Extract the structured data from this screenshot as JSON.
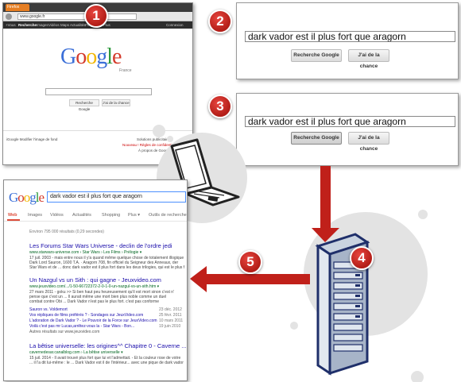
{
  "steps": {
    "s1": "1",
    "s2": "2",
    "s3": "3",
    "s4": "4",
    "s5": "5"
  },
  "browser": {
    "tab_label": "Firefox",
    "url": "www.google.fr",
    "nav_items": [
      "+Vous",
      "Recherche",
      "Images",
      "Vidéos",
      "Maps",
      "Actualités",
      "Play",
      "Gmail",
      "Plus"
    ],
    "connect": "Connexion",
    "logo_letters": [
      "G",
      "o",
      "o",
      "g",
      "l",
      "e"
    ],
    "logo_colors": [
      "#3b6fd8",
      "#d43a2a",
      "#f2b705",
      "#3b6fd8",
      "#2e9a3e",
      "#d43a2a"
    ],
    "country": "France",
    "btn_search": "Recherche Google",
    "btn_lucky": "J'ai de la chance",
    "footer_left": "iGoogle    Modifier l'image de fond",
    "footer_right_1": "Solutions publicitaires",
    "footer_right_2": "Nouveau ! Règles de confidentialité",
    "footer_right_3": "À propos de Google"
  },
  "query_panel_2": {
    "query": "dark vador est il plus fort que aragorn",
    "btn_search": "Recherche Google",
    "btn_lucky": "J'ai de la chance"
  },
  "query_panel_3": {
    "query": "dark vador est il plus fort que aragorn",
    "btn_search": "Recherche Google",
    "btn_lucky": "J'ai de la chance"
  },
  "results": {
    "query": "dark vador est il plus fort que aragorn",
    "nav": [
      "Web",
      "Images",
      "Vidéos",
      "Actualités",
      "Shopping",
      "Plus ▾",
      "Outils de recherche"
    ],
    "count": "Environ 795 000 résultats (0,29 secondes)",
    "items": [
      {
        "title": "Les Forums Star Wars Universe - declin de l'ordre jedi",
        "url": "www.starwars-universe.com › Star Wars › Les Films › Prélogie ▾",
        "snippets": [
          "17 juil. 2003 - mais entre nous il y'a quand même quelque chose de totalement illogique",
          "Dark Lord Sauron, 1600 T.A. · Aragorn 708, fin officiel du Seigneur des Anneaux, der",
          "Star Wars et de ... donc dark vador est il plus fort dans les deux trilogies, qui est le plus fort."
        ]
      },
      {
        "title": "Un Nazgul vs un Sith : qui gagne - Jeuxvideo.com",
        "url": "www.jeuxvideo.com/.../1-50-66722372-2-0-1-0-un-nazgul-vs-un-sith.htm ▾",
        "snippets": [
          "27 mars 2011 - goku >> Si ben haut peu heureusement qu'il est mort sinon c'est n'",
          "pense que c'est un ... Il aurait même une mort bien plus noble comme un duel",
          "combat contre Obi ... Dark Vador n'est pas le plus fort. c'est pas conforme"
        ],
        "sublinks": [
          {
            "text": "Sauron vs. Voldemort",
            "date": "23 déc. 2012"
          },
          {
            "text": "Vos répliques de films préférés ? - Sondages sur JeuxVideo.com",
            "date": "25 févr. 2011"
          },
          {
            "text": "L'adoration de Dark Vador ? - Le Pouvoir de la Force sur JeuxVideo.com",
            "date": "10 mars 2011"
          },
          {
            "text": "Voilà c'est pas mr Lucas,arrêtez-vous la - Star Wars - Bon...",
            "date": "19 juin 2010"
          }
        ],
        "more": "Autres résultats sur www.jeuxvideo.com"
      },
      {
        "title": "La bêtise universelle: les origines^^ Chapitre 0 - Caverne ...",
        "url": "cavernedesar.canalblog.com › La bêtise universelle ▾",
        "snippets": [
          "15 juil. 2014 - Il avait trouvé plus fort que lui et l'admettait. - Et la couleur rose de votre",
          "... il l'a dit lui-même : le ... Dark Vador est il de l'intérieur... avec une pique de dark vador bleu"
        ]
      }
    ]
  }
}
